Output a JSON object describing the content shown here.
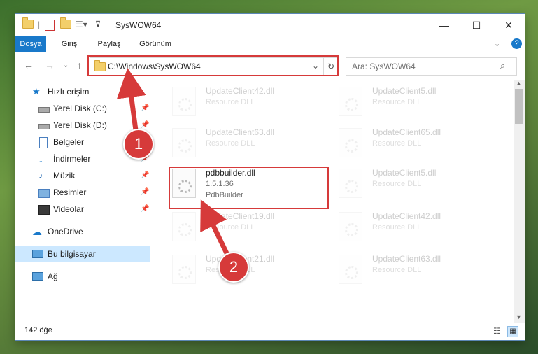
{
  "window": {
    "title": "SysWOW64"
  },
  "ribbon": {
    "tabs": [
      "Dosya",
      "Giriş",
      "Paylaş",
      "Görünüm"
    ]
  },
  "address": {
    "path": "C:\\Windows\\SysWOW64"
  },
  "search": {
    "placeholder": "Ara: SysWOW64"
  },
  "sidebar": {
    "quick_access": "Hızlı erişim",
    "items": [
      "Yerel Disk (C:)",
      "Yerel Disk (D:)",
      "Belgeler",
      "İndirmeler",
      "Müzik",
      "Resimler",
      "Videolar"
    ],
    "onedrive": "OneDrive",
    "this_pc": "Bu bilgisayar",
    "network": "Ağ"
  },
  "files": [
    {
      "name": "UpdateClient42.dll",
      "sub": "Resource DLL"
    },
    {
      "name": "UpdateClient5.dll",
      "sub": "Resource DLL"
    },
    {
      "name": "UpdateClient63.dll",
      "sub": "Resource DLL"
    },
    {
      "name": "UpdateClient65.dll",
      "sub": "Resource DLL"
    },
    {
      "name": "pdbbuilder.dll",
      "version": "1.5.1.36",
      "sub": "PdbBuilder"
    },
    {
      "name": "UpdateClient5.dll",
      "sub": "Resource DLL"
    },
    {
      "name": "UpdateClient19.dll",
      "sub": "Resource DLL"
    },
    {
      "name": "UpdateClient42.dll",
      "sub": "Resource DLL"
    },
    {
      "name": "UpdateClient21.dll",
      "sub": "Resource DLL"
    },
    {
      "name": "UpdateClient63.dll",
      "sub": "Resource DLL"
    }
  ],
  "status": {
    "count": "142 öğe"
  },
  "annotations": [
    "1",
    "2"
  ],
  "colors": {
    "accent": "#1979ca",
    "highlight": "#d63a3a",
    "selected": "#cce8ff"
  }
}
